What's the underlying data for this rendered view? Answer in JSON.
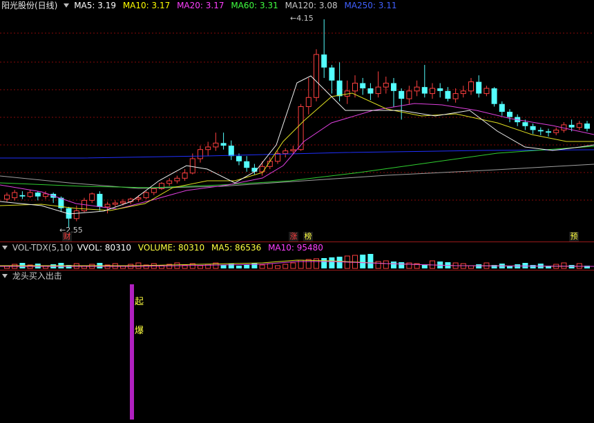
{
  "main": {
    "title": "阳光股份(日线)",
    "ma": [
      {
        "label": "MA5: 3.19",
        "color": "#ffffff"
      },
      {
        "label": "MA10: 3.17",
        "color": "#ffff00"
      },
      {
        "label": "MA20: 3.17",
        "color": "#ff40ff"
      },
      {
        "label": "MA60: 3.31",
        "color": "#40ff40"
      },
      {
        "label": "MA120: 3.08",
        "color": "#c8c8c8"
      },
      {
        "label": "MA250: 3.11",
        "color": "#4060ff"
      }
    ],
    "high_label": "4.15",
    "low_label": "2.55",
    "tags": [
      "财",
      "涨",
      "榜",
      "预"
    ]
  },
  "volume": {
    "title": "VOL-TDX(5,10)",
    "vvol": "VVOL: 80310",
    "volume": "VOLUME: 80310",
    "ma5": "MA5: 86536",
    "ma10": "MA10: 95480"
  },
  "indicator": {
    "title": "龙头买入出击",
    "text1": "起",
    "text2": "爆"
  },
  "colors": {
    "up": "#ff4040",
    "down": "#54ffff",
    "grid": "#8a0a0a"
  }
}
